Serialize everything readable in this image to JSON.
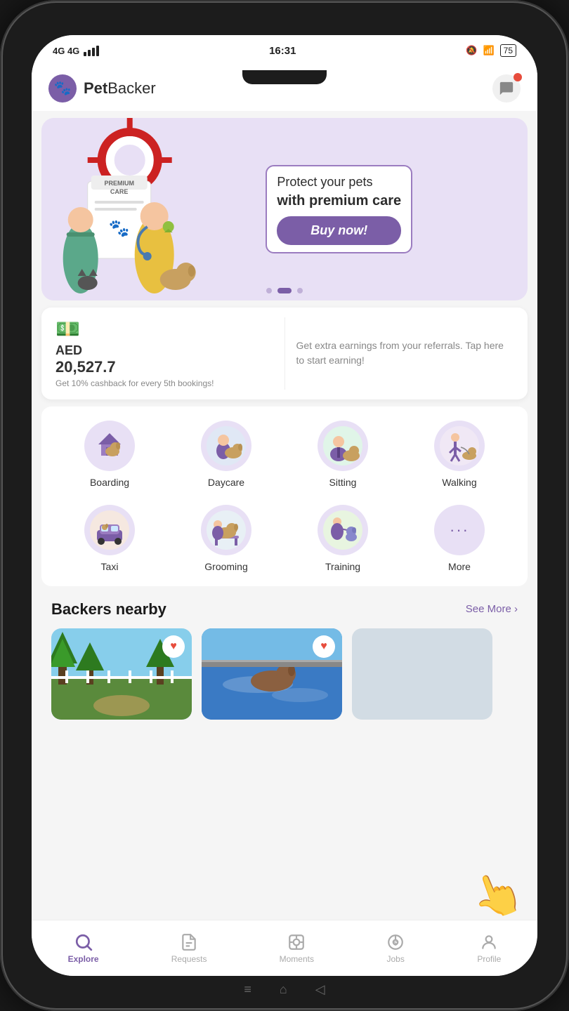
{
  "status_bar": {
    "network": "4G 4G",
    "time": "16:31",
    "battery": "75"
  },
  "header": {
    "app_name_bold": "Pet",
    "app_name_light": "Backer"
  },
  "banner": {
    "line1": "Protect your pets",
    "line2": "with premium care",
    "button_label": "Buy now!",
    "dots": [
      false,
      true,
      false
    ]
  },
  "earnings": {
    "currency": "AED",
    "amount": "20,527.7",
    "cashback_note": "Get 10% cashback for every 5th bookings!",
    "referral_text": "Get extra earnings from your referrals. Tap here to start earning!"
  },
  "services": [
    {
      "label": "Boarding",
      "id": "boarding"
    },
    {
      "label": "Daycare",
      "id": "daycare"
    },
    {
      "label": "Sitting",
      "id": "sitting"
    },
    {
      "label": "Walking",
      "id": "walking"
    },
    {
      "label": "Taxi",
      "id": "taxi"
    },
    {
      "label": "Grooming",
      "id": "grooming"
    },
    {
      "label": "Training",
      "id": "training"
    },
    {
      "label": "More",
      "id": "more"
    }
  ],
  "backers_section": {
    "title": "Backers nearby",
    "see_more": "See More ›"
  },
  "bottom_nav": [
    {
      "label": "Explore",
      "id": "explore",
      "active": true
    },
    {
      "label": "Requests",
      "id": "requests",
      "active": false
    },
    {
      "label": "Moments",
      "id": "moments",
      "active": false
    },
    {
      "label": "Jobs",
      "id": "jobs",
      "active": false
    },
    {
      "label": "Profile",
      "id": "profile",
      "active": false
    }
  ]
}
